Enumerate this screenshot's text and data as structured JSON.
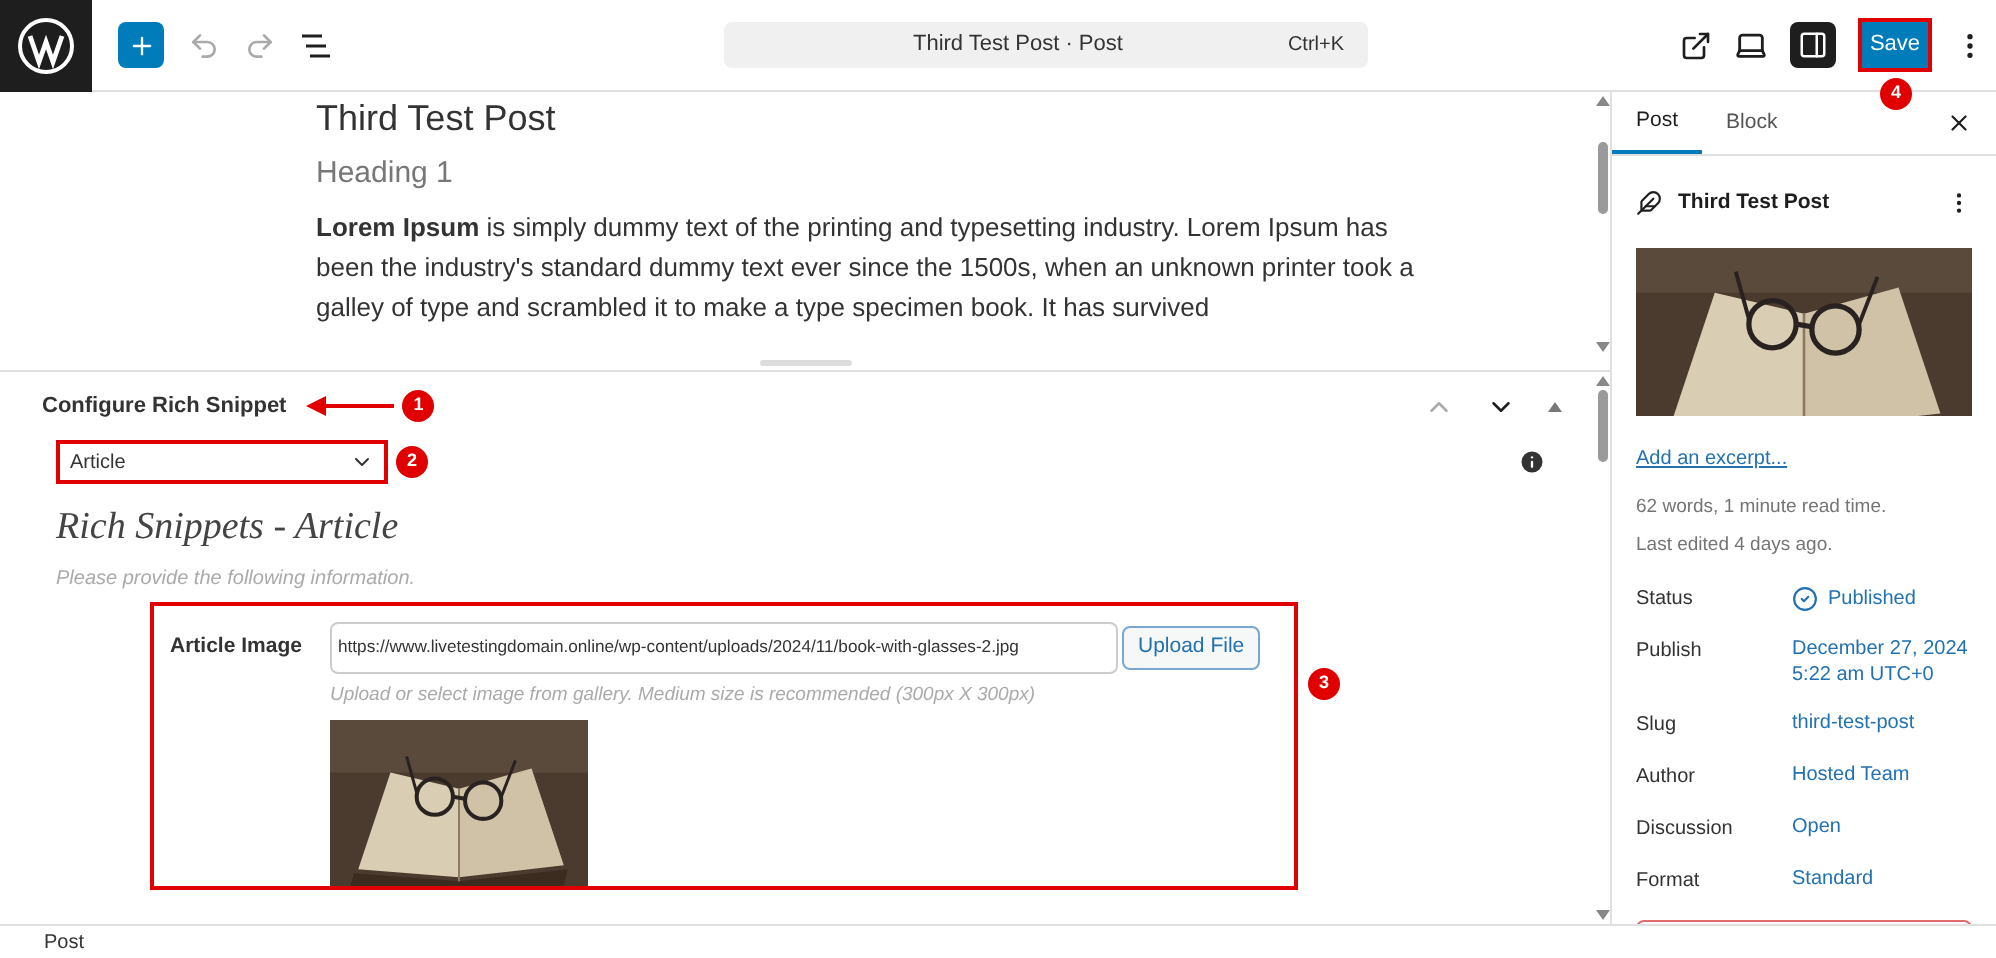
{
  "toolbar": {
    "document_title": "Third Test Post · Post",
    "shortcut": "Ctrl+K",
    "save_button": "Save"
  },
  "editor": {
    "title": "Third Test Post",
    "heading": "Heading 1",
    "paragraph": "**Lorem Ipsum** is simply dummy text of the printing and typesetting industry. Lorem Ipsum has been the industry's standard dummy text ever since the 1500s, when an unknown printer took a galley of type and scrambled it to make a type specimen book. It has survived"
  },
  "meta_box": {
    "title": "Configure Rich Snippet",
    "schema_select": {
      "value": "Article"
    },
    "heading": "Rich Snippets - Article",
    "hint": "Please provide the following information.",
    "fields": [
      {
        "label": "Article Image",
        "value": "https://www.livetestingdomain.online/wp-content/uploads/2024/11/book-with-glasses-2.jpg",
        "button": "Upload File",
        "help": "Upload or select image from gallery. Medium size is recommended (300px X 300px)"
      }
    ]
  },
  "annotations": [
    {
      "number": "1"
    },
    {
      "number": "2"
    },
    {
      "number": "3"
    },
    {
      "number": "4"
    }
  ],
  "sidebar": {
    "tabs": [
      {
        "label": "Post",
        "selected": true
      },
      {
        "label": "Block",
        "selected": false
      }
    ],
    "post_title": "Third Test Post",
    "excerpt_link": "Add an excerpt...",
    "stats": "62 words, 1 minute read time.",
    "last_edited": "Last edited 4 days ago.",
    "properties": [
      {
        "label": "Status",
        "kind": "status",
        "value_lines": [
          "Published"
        ]
      },
      {
        "label": "Publish",
        "kind": "link",
        "value_lines": [
          "December 27, 2024",
          "5:22 am UTC+0"
        ]
      },
      {
        "label": "Slug",
        "kind": "link",
        "value_lines": [
          "third-test-post"
        ]
      },
      {
        "label": "Author",
        "kind": "link",
        "value_lines": [
          "Hosted Team"
        ]
      },
      {
        "label": "Discussion",
        "kind": "link",
        "value_lines": [
          "Open"
        ]
      },
      {
        "label": "Format",
        "kind": "link",
        "value_lines": [
          "Standard"
        ]
      }
    ]
  },
  "status_bar": {
    "breadcrumb": "Post"
  }
}
